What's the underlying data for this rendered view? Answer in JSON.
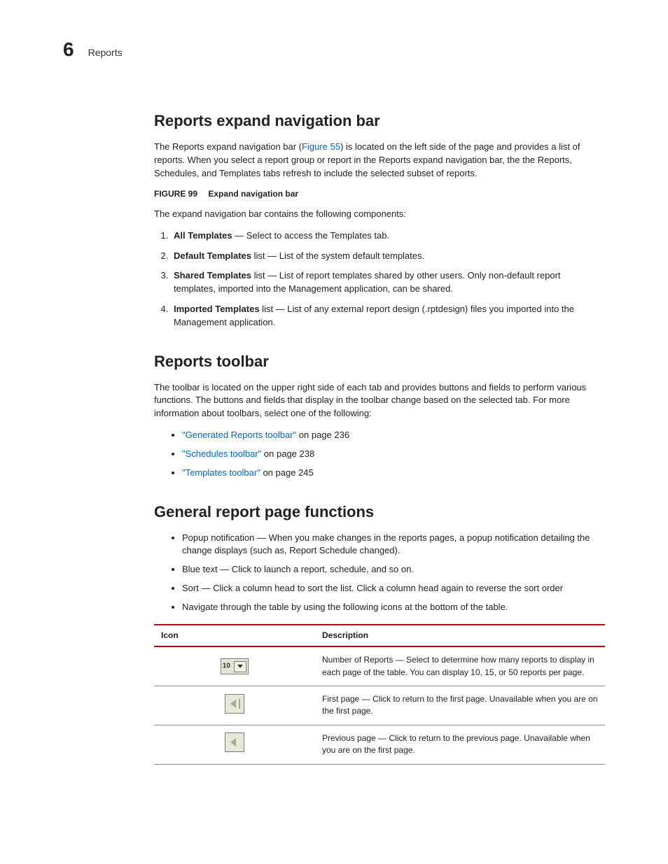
{
  "header": {
    "chapter_number": "6",
    "chapter_title": "Reports"
  },
  "section1": {
    "heading": "Reports expand navigation bar",
    "intro_pre": "The Reports expand navigation bar (",
    "intro_link": "Figure 55",
    "intro_post": ") is located on the left side of the page and provides a list of reports. When you select a report group or report in the Reports expand navigation bar, the the Reports, Schedules, and Templates tabs refresh to include the selected subset of reports.",
    "figure_label": "FIGURE 99",
    "figure_title": "Expand navigation bar",
    "lead_in": "The expand navigation bar contains the following components:",
    "items": [
      {
        "term": "All Templates",
        "desc": " — Select to access the Templates tab."
      },
      {
        "term": "Default Templates",
        "desc": " list — List of the system default templates."
      },
      {
        "term": "Shared Templates",
        "desc": " list — List of report templates shared by other users. Only non-default report templates, imported into the Management application, can be shared."
      },
      {
        "term": "Imported Templates",
        "desc": " list — List of any external report design (.rptdesign) files you imported into the Management application."
      }
    ]
  },
  "section2": {
    "heading": "Reports toolbar",
    "intro": "The toolbar is located on the upper right side of each tab and provides buttons and fields to perform various functions. The buttons and fields that display in the toolbar change based on the selected tab. For more information about toolbars, select one of the following:",
    "links": [
      {
        "link": "\"Generated Reports toolbar\"",
        "tail": " on page 236"
      },
      {
        "link": "\"Schedules toolbar\"",
        "tail": " on page 238"
      },
      {
        "link": "\"Templates toolbar\"",
        "tail": " on page 245"
      }
    ]
  },
  "section3": {
    "heading": "General report page functions",
    "bullets": [
      "Popup notification — When you make changes in the reports pages, a popup notification detailing the change displays (such as, Report Schedule changed).",
      "Blue text — Click to launch a report, schedule, and so on.",
      "Sort — Click a column head to sort the list. Click a column head again to reverse the sort order",
      "Navigate through the table by using the following icons at the bottom of the table."
    ],
    "table": {
      "col_icon": "Icon",
      "col_desc": "Description",
      "rows": [
        {
          "icon_type": "dropdown",
          "icon_value": "10",
          "desc": "Number of Reports — Select to determine how many reports to display in each page of the table. You can display 10, 15, or 50 reports per page."
        },
        {
          "icon_type": "first",
          "desc": "First page — Click to return to the first page. Unavailable when you are on the first page."
        },
        {
          "icon_type": "prev",
          "desc": "Previous page — Click to return to the previous page. Unavailable when you are on the first page."
        }
      ]
    }
  }
}
